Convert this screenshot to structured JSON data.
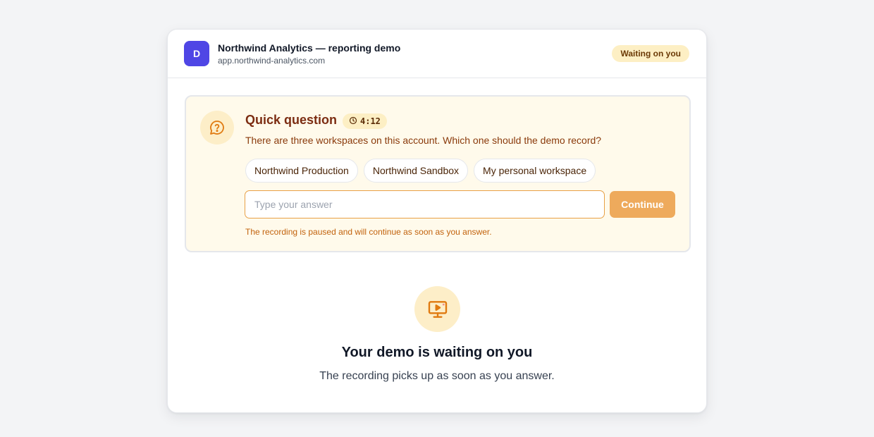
{
  "header": {
    "avatar_letter": "D",
    "title": "Northwind Analytics — reporting demo",
    "url": "app.northwind-analytics.com",
    "status": "Waiting on you"
  },
  "question": {
    "icon": "question-bubble-icon",
    "title": "Quick question",
    "timer_icon": "clock-icon",
    "timer": "4:12",
    "text": "There are three workspaces on this account. Which one should the demo record?",
    "options": [
      "Northwind Production",
      "Northwind Sandbox",
      "My personal workspace"
    ],
    "input_placeholder": "Type your answer",
    "input_value": "",
    "continue_label": "Continue",
    "note": "The recording is paused and will continue as soon as you answer."
  },
  "waiting": {
    "icon": "monitor-play-icon",
    "title": "Your demo is waiting on you",
    "subtitle": "The recording picks up as soon as you answer."
  },
  "colors": {
    "accent": "#4f46e5",
    "warning_bg": "#fffaeb",
    "warning_text": "#7c2d12",
    "button": "#eeaa5c"
  }
}
